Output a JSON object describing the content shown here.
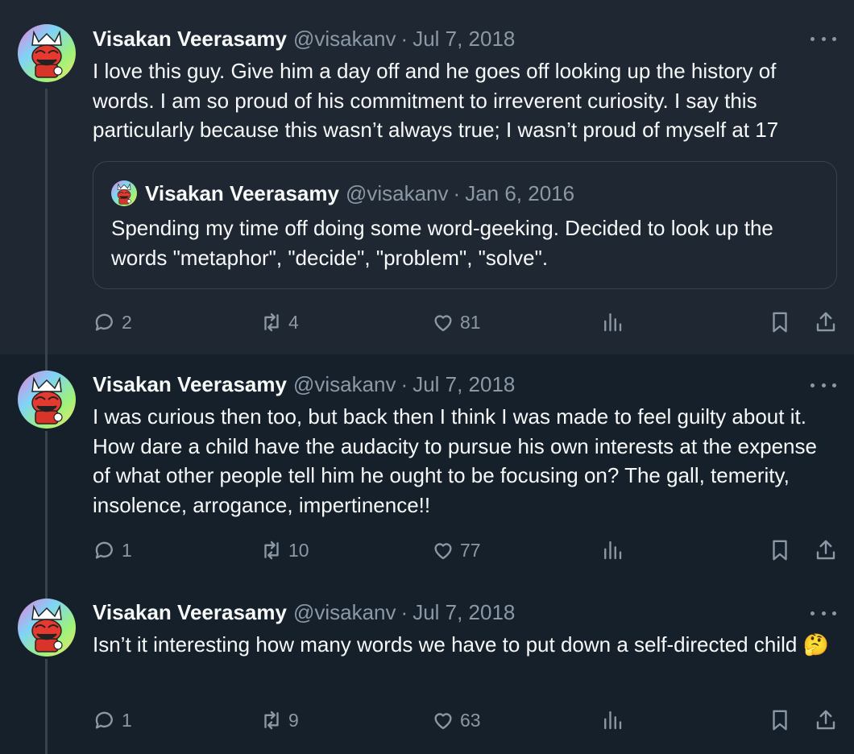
{
  "tweets": [
    {
      "name": "Visakan Veerasamy",
      "handle": "@visakanv",
      "separator": "·",
      "date": "Jul 7, 2018",
      "text": "I love this guy. Give him a day off and he goes off looking up the history of words. I am so proud of his commitment to irreverent curiosity. I say this particularly because this wasn’t always true; I wasn’t proud of myself at 17",
      "quote": {
        "name": "Visakan Veerasamy",
        "handle": "@visakanv",
        "separator": "·",
        "date": "Jan 6, 2016",
        "text": "Spending my time off doing some word-geeking. Decided to look up the words \"metaphor\", \"decide\", \"problem\", \"solve\"."
      },
      "replies": "2",
      "retweets": "4",
      "likes": "81"
    },
    {
      "name": "Visakan Veerasamy",
      "handle": "@visakanv",
      "separator": "·",
      "date": "Jul 7, 2018",
      "text": "I was curious then too, but back then I think I was made to feel guilty about it. How dare a child have the audacity to pursue his own interests at the expense of what other people tell him he ought to be focusing on? The gall, temerity, insolence, arrogance, impertinence!!",
      "replies": "1",
      "retweets": "10",
      "likes": "77"
    },
    {
      "name": "Visakan Veerasamy",
      "handle": "@visakanv",
      "separator": "·",
      "date": "Jul 7, 2018",
      "text": "Isn’t it interesting how many words we have to put down a self-directed child 🤔",
      "replies": "1",
      "retweets": "9",
      "likes": "63"
    }
  ],
  "icons": {
    "reply": "reply-icon",
    "retweet": "retweet-icon",
    "like": "heart-icon",
    "views": "views-icon",
    "bookmark": "bookmark-icon",
    "share": "share-icon",
    "more": "more-icon"
  },
  "colors": {
    "background": "#15202b",
    "highlight_background": "#1e2732",
    "text": "#f7f9f9",
    "muted": "#8b98a5",
    "border": "#38444d"
  }
}
